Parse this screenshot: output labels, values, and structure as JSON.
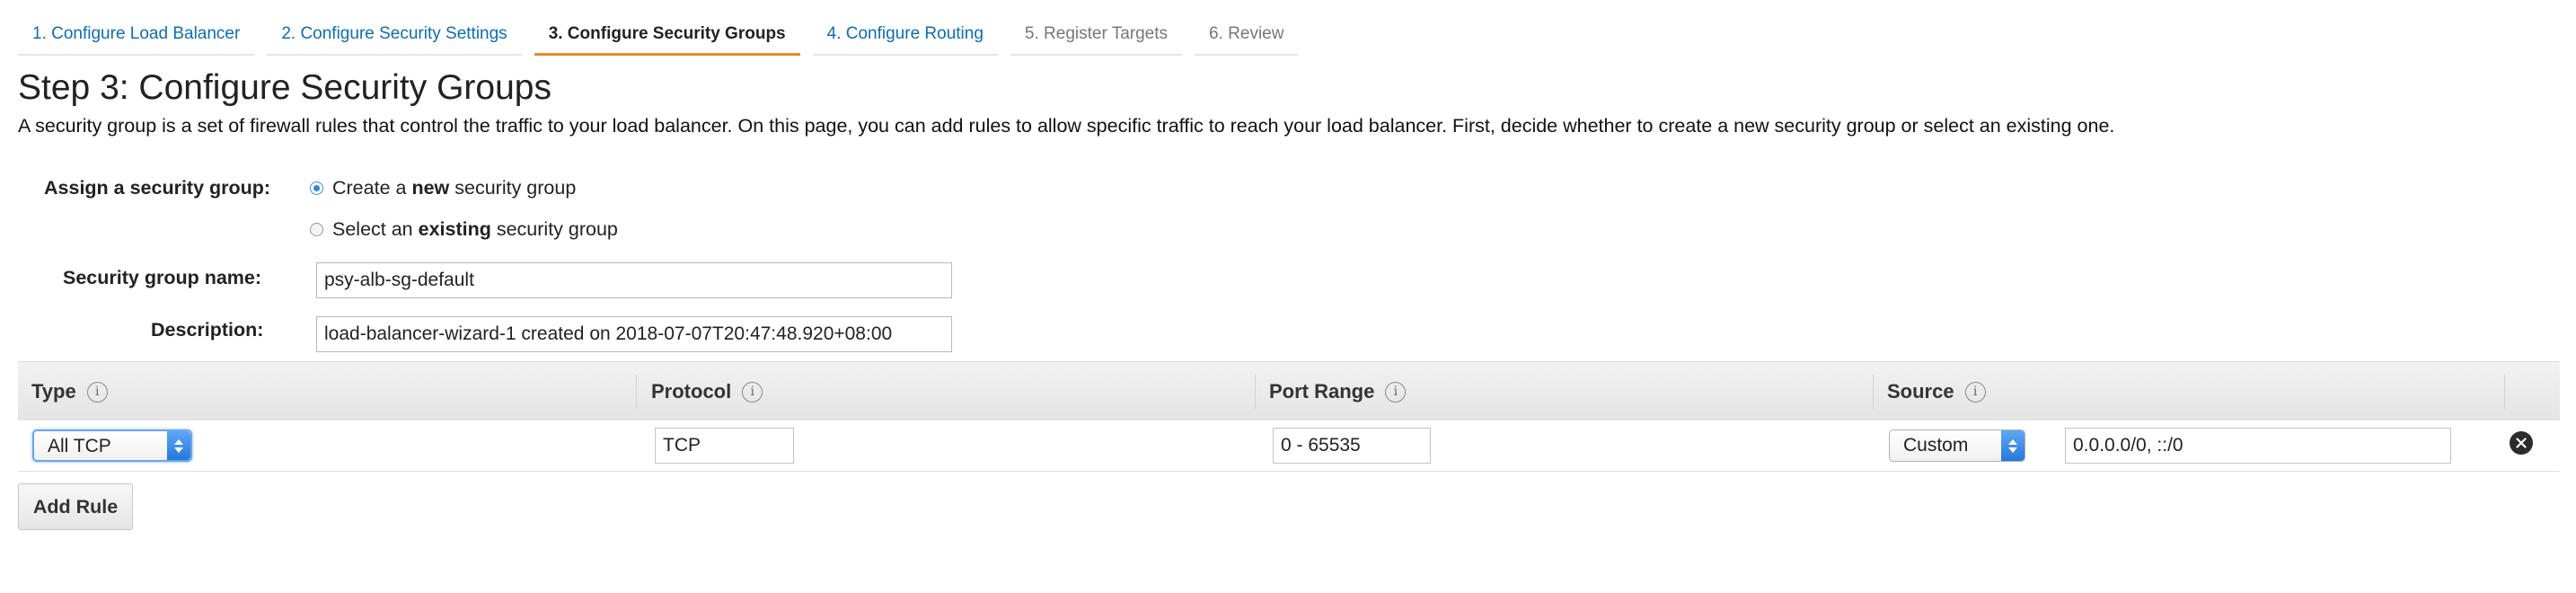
{
  "wizard": {
    "steps": [
      {
        "label": "1. Configure Load Balancer",
        "state": "link"
      },
      {
        "label": "2. Configure Security Settings",
        "state": "link"
      },
      {
        "label": "3. Configure Security Groups",
        "state": "active"
      },
      {
        "label": "4. Configure Routing",
        "state": "link"
      },
      {
        "label": "5. Register Targets",
        "state": "disabled"
      },
      {
        "label": "6. Review",
        "state": "disabled"
      }
    ]
  },
  "page": {
    "title": "Step 3: Configure Security Groups",
    "description": "A security group is a set of firewall rules that control the traffic to your load balancer. On this page, you can add rules to allow specific traffic to reach your load balancer. First, decide whether to create a new security group or select an existing one."
  },
  "form": {
    "assign_label": "Assign a security group:",
    "option_new": {
      "pre": "Create a ",
      "bold": "new",
      "post": " security group",
      "checked": true
    },
    "option_existing": {
      "pre": "Select an ",
      "bold": "existing",
      "post": " security group",
      "checked": false
    },
    "name_label": "Security group name:",
    "name_value": "psy-alb-sg-default",
    "description_label": "Description:",
    "description_value": "load-balancer-wizard-1 created on 2018-07-07T20:47:48.920+08:00"
  },
  "rules_table": {
    "headers": [
      "Type",
      "Protocol",
      "Port Range",
      "Source"
    ],
    "rows": [
      {
        "type": "All TCP",
        "protocol": "TCP",
        "port_range": "0 - 65535",
        "source_mode": "Custom",
        "source_value": "0.0.0.0/0, ::/0"
      }
    ]
  },
  "actions": {
    "add_rule_label": "Add Rule"
  },
  "colors": {
    "link": "#0b6eb5",
    "active_tab_underline": "#ec8a22",
    "select_arrow": "#2678dc"
  },
  "icons": {
    "info": "info-icon",
    "remove": "remove-rule-icon",
    "select_arrows": "chevron-up-down-icon"
  }
}
